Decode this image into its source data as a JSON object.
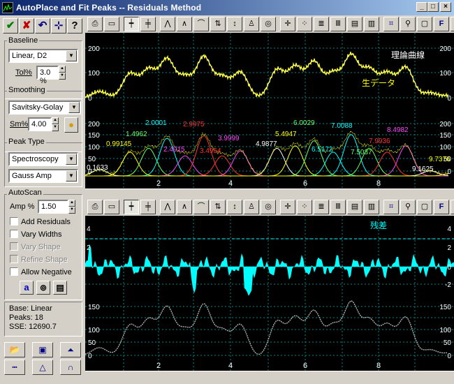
{
  "window": {
    "title": "AutoPlace and Fit Peaks -- Residuals Method"
  },
  "titlebar_buttons": [
    "_",
    "□",
    "×"
  ],
  "left": {
    "toolbar": [
      {
        "name": "accept-button",
        "glyph": "✔",
        "color": "#008000"
      },
      {
        "name": "cancel-button",
        "glyph": "✘",
        "color": "#c00000"
      },
      {
        "name": "undo-button",
        "glyph": "↶",
        "color": "#000080"
      },
      {
        "name": "add-peak-button",
        "glyph": "⊹",
        "color": "#000080"
      },
      {
        "name": "help-button",
        "glyph": "?",
        "color": "#000000"
      }
    ],
    "baseline": {
      "label": "Baseline",
      "value": "Linear, D2",
      "tol_label": "Tol%",
      "tol_value": "3.0 %"
    },
    "smoothing": {
      "label": "Smoothing",
      "value": "Savitsky-Golay",
      "sm_label": "Sm%",
      "sm_value": "4.00"
    },
    "peak_type": {
      "label": "Peak Type",
      "value1": "Spectroscopy",
      "value2": "Gauss Amp"
    },
    "autoscan": {
      "label": "AutoScan",
      "amp_label": "Amp %",
      "amp_value": "1.50",
      "checks": [
        {
          "label": "Add Residuals",
          "checked": false,
          "disabled": false
        },
        {
          "label": "Vary Widths",
          "checked": false,
          "disabled": false
        },
        {
          "label": "Vary Shape",
          "checked": false,
          "disabled": true
        },
        {
          "label": "Refine Shape",
          "checked": false,
          "disabled": true
        },
        {
          "label": "Allow Negative",
          "checked": false,
          "disabled": false
        }
      ]
    },
    "status": {
      "base": "Base: Linear",
      "peaks": "Peaks:  18",
      "sse": "SSE:  12690.7"
    }
  },
  "top_plot": {
    "label_theory": "理論曲線",
    "label_raw": "生データ",
    "y_ticks_upper": [
      "200",
      "100",
      "0"
    ],
    "y_ticks_lower": [
      "200",
      "150",
      "100",
      "50",
      "0"
    ],
    "x_ticks": [
      "2",
      "4",
      "6",
      "8"
    ],
    "peak_labels": [
      {
        "text": "0.1633",
        "color": "#ffffff"
      },
      {
        "text": "0.99145",
        "color": "#ffff00"
      },
      {
        "text": "1.4962",
        "color": "#66ff66"
      },
      {
        "text": "2.0001",
        "color": "#00ffff"
      },
      {
        "text": "2.4915",
        "color": "#ff44ff"
      },
      {
        "text": "2.9975",
        "color": "#ff3333"
      },
      {
        "text": "3.4954",
        "color": "#ff3333"
      },
      {
        "text": "3.9999",
        "color": "#ff44ff"
      },
      {
        "text": "4.9877",
        "color": "#ffffff"
      },
      {
        "text": "5.4947",
        "color": "#ffff00"
      },
      {
        "text": "6.0029",
        "color": "#66ff66"
      },
      {
        "text": "6.5172",
        "color": "#00ffff"
      },
      {
        "text": "7.0088",
        "color": "#00ffff"
      },
      {
        "text": "7.5037",
        "color": "#66ff66"
      },
      {
        "text": "7.9936",
        "color": "#ff3333"
      },
      {
        "text": "8.4982",
        "color": "#ff44ff"
      },
      {
        "text": "9.1625",
        "color": "#ffffff"
      },
      {
        "text": "9.7376",
        "color": "#ffff00"
      }
    ]
  },
  "bottom_plot": {
    "label_residual": "残差",
    "y_ticks_res": [
      "4",
      "2",
      "0",
      "-2"
    ],
    "y_ticks_data": [
      "150",
      "100",
      "50",
      "0"
    ],
    "x_ticks": [
      "2",
      "4",
      "6",
      "8"
    ]
  },
  "colors": {
    "plot_bg": "#000000",
    "grid": "#008888",
    "residual": "#00ffff",
    "fit": "#ffffcc",
    "raw": "#ffff00"
  }
}
